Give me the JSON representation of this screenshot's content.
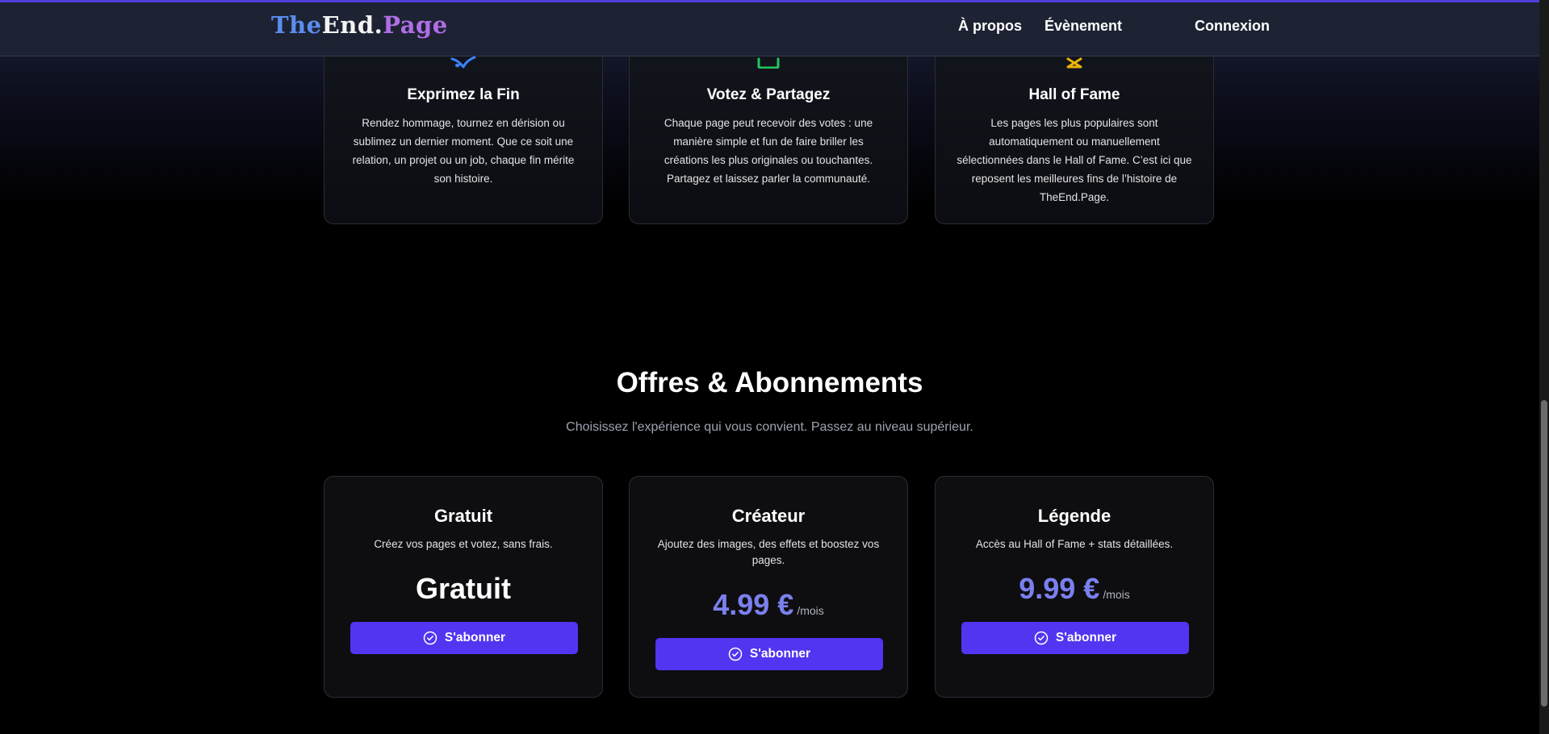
{
  "header": {
    "logo_part1": "The",
    "logo_part2": "End.",
    "logo_part3": "Page",
    "nav": {
      "about": "À propos",
      "event": "Évènement",
      "login": "Connexion"
    }
  },
  "features": [
    {
      "icon": "sparkle-icon",
      "icon_color": "#3b82f6",
      "title": "Exprimez la Fin",
      "text": "Rendez hommage, tournez en dérision ou sublimez un dernier moment. Que ce soit une relation, un projet ou un job, chaque fin mérite son histoire."
    },
    {
      "icon": "thumbs-up-icon",
      "icon_color": "#22c55e",
      "title": "Votez & Partagez",
      "text": "Chaque page peut recevoir des votes : une manière simple et fun de faire briller les créations les plus originales ou touchantes. Partagez et laissez parler la communauté."
    },
    {
      "icon": "trophy-icon",
      "icon_color": "#eab308",
      "title": "Hall of Fame",
      "text": "Les pages les plus populaires sont automatiquement ou manuellement sélectionnées dans le Hall of Fame. C’est ici que reposent les meilleures fins de l’histoire de TheEnd.Page."
    }
  ],
  "pricing": {
    "title": "Offres & Abonnements",
    "subtitle": "Choisissez l'expérience qui vous convient. Passez au niveau supérieur.",
    "plans": [
      {
        "name": "Gratuit",
        "description": "Créez vos pages et votez, sans frais.",
        "price": "Gratuit",
        "unit": "",
        "button": "S'abonner"
      },
      {
        "name": "Créateur",
        "description": "Ajoutez des images, des effets et boostez vos pages.",
        "price": "4.99 €",
        "unit": "/mois",
        "button": "S'abonner"
      },
      {
        "name": "Légende",
        "description": "Accès au Hall of Fame + stats détaillées.",
        "price": "9.99 €",
        "unit": "/mois",
        "button": "S'abonner"
      }
    ]
  },
  "colors": {
    "accent": "#5135f0",
    "price": "#7b80ee",
    "background": "#000000"
  }
}
